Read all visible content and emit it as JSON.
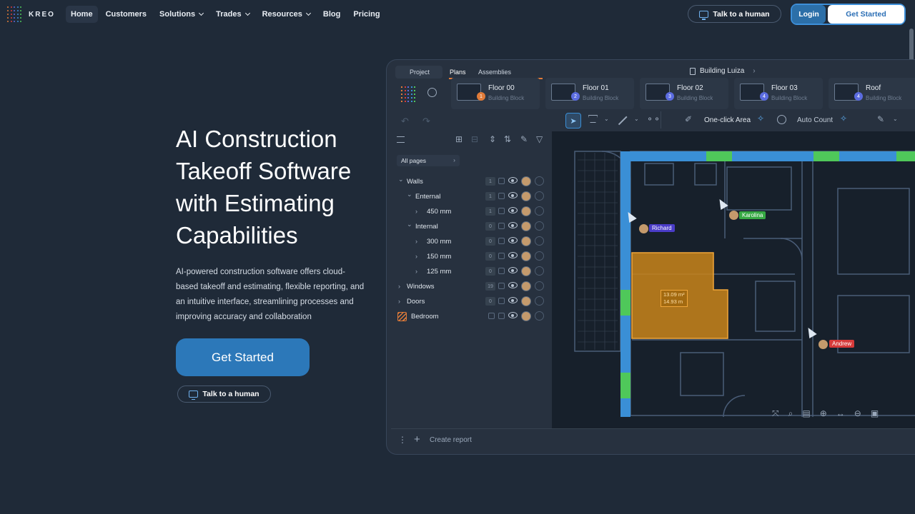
{
  "nav": {
    "brand": "KREO",
    "links": [
      {
        "label": "Home",
        "active": true,
        "dropdown": false
      },
      {
        "label": "Customers",
        "active": false,
        "dropdown": false
      },
      {
        "label": "Solutions",
        "active": false,
        "dropdown": true
      },
      {
        "label": "Trades",
        "active": false,
        "dropdown": true
      },
      {
        "label": "Resources",
        "active": false,
        "dropdown": true
      },
      {
        "label": "Blog",
        "active": false,
        "dropdown": false
      },
      {
        "label": "Pricing",
        "active": false,
        "dropdown": false
      }
    ],
    "talk_label": "Talk to a human",
    "login_label": "Login",
    "get_started_label": "Get Started"
  },
  "hero": {
    "title_lines": [
      "AI Construction",
      "Takeoff Software",
      "with Estimating",
      "Capabilities"
    ],
    "subtitle_lines": [
      "AI-powered construction software offers cloud-",
      "based takeoff and estimating, flexible reporting, and",
      "an intuitive interface, streamlining processes and",
      "improving accuracy and collaboration"
    ],
    "cta_label": "Get Started",
    "talk_label": "Talk to a human"
  },
  "app": {
    "tabs": {
      "project": "Project",
      "plans": "Plans",
      "assemblies": "Assemblies"
    },
    "building": "Building Luiza",
    "floors": [
      {
        "name": "Floor 00",
        "sub": "Building Block",
        "badge": "1",
        "badge_color": "#e07b39"
      },
      {
        "name": "Floor 01",
        "sub": "Building Block",
        "badge": "2",
        "badge_color": "#5b6ce0"
      },
      {
        "name": "Floor 02",
        "sub": "Building Block",
        "badge": "3",
        "badge_color": "#5b6ce0"
      },
      {
        "name": "Floor 03",
        "sub": "Building Block",
        "badge": "4",
        "badge_color": "#5b6ce0"
      },
      {
        "name": "Roof",
        "sub": "Building Block",
        "badge": "4",
        "badge_color": "#5b6ce0"
      }
    ],
    "toolbar": {
      "one_click": "One-click Area",
      "auto_count": "Auto Count"
    },
    "all_pages": "All pages",
    "tree": [
      {
        "label": "Walls",
        "indent": 0,
        "caret": "down",
        "count": "1"
      },
      {
        "label": "Enternal",
        "indent": 1,
        "caret": "down",
        "count": "1"
      },
      {
        "label": "450 mm",
        "indent": 2,
        "caret": "right",
        "count": "1"
      },
      {
        "label": "Internal",
        "indent": 1,
        "caret": "down",
        "count": "0"
      },
      {
        "label": "300 mm",
        "indent": 2,
        "caret": "right",
        "count": "0"
      },
      {
        "label": "150 mm",
        "indent": 2,
        "caret": "right",
        "count": "0"
      },
      {
        "label": "125 mm",
        "indent": 2,
        "caret": "right",
        "count": "0"
      },
      {
        "label": "Windows",
        "indent": 0,
        "caret": "right",
        "count": "19"
      },
      {
        "label": "Doors",
        "indent": 0,
        "caret": "right",
        "count": "0"
      },
      {
        "label": "Bedroom",
        "indent": 0,
        "caret": "none",
        "count": ""
      }
    ],
    "measure": {
      "area": "13.09 m²",
      "length": "14.93 m"
    },
    "users": {
      "richard": "Richard",
      "karolina": "Karolina",
      "andrew": "Andrew"
    },
    "create_report": "Create report",
    "colors": {
      "wall": "#3a8fd6",
      "window": "#4fc85a",
      "room": "#c9851a",
      "accent": "#2c78b9"
    }
  }
}
